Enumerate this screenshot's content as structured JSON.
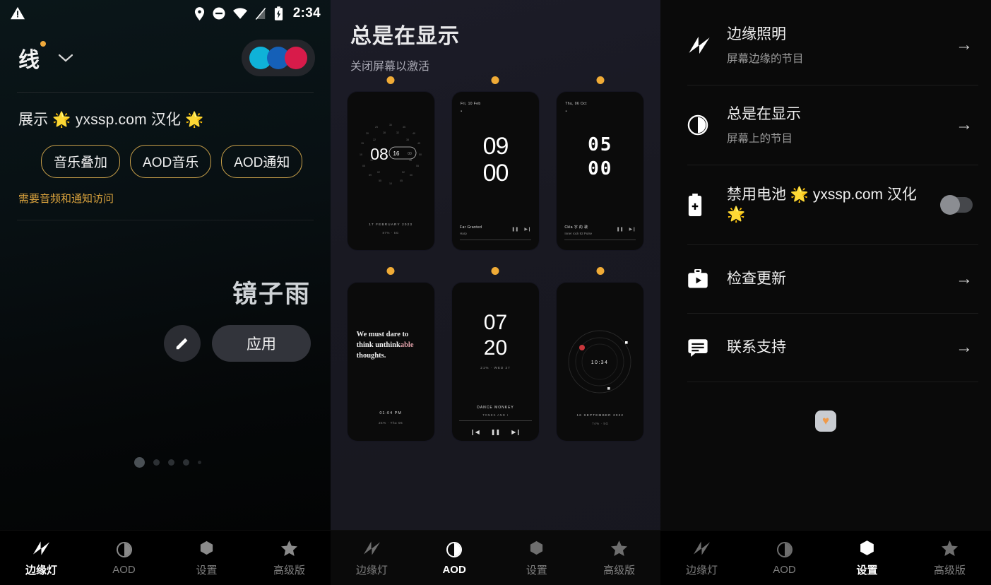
{
  "statusbar": {
    "warning_icon": "warning-triangle",
    "location_icon": "location-pin",
    "dnd_icon": "do-not-disturb",
    "wifi_icon": "wifi",
    "signal_icon": "signal-off",
    "battery_icon": "battery-charging",
    "time": "2:34"
  },
  "panel1": {
    "preset_name": "线",
    "chevron": "⌄",
    "swatches": [
      "#0fb2d8",
      "#1560b8",
      "#d81b4a"
    ],
    "demo": {
      "title": "展示 🌟 yxssp.com 汉化 🌟",
      "chips": [
        "音乐叠加",
        "AOD音乐",
        "AOD通知"
      ],
      "note": "需要音频和通知访问"
    },
    "theme_name": "镜子雨",
    "edit_icon": "pencil-icon",
    "apply_label": "应用",
    "page_dots": 5,
    "active_dot": 0
  },
  "panel2": {
    "title": "总是在显示",
    "subtitle": "关闭屏幕以激活",
    "cards": [
      {
        "style": "dial",
        "hour": "08",
        "minute": "16",
        "second": "00",
        "footer_date": "17 FEBRUARY 2023",
        "footer_meta": "87%  ·  5G"
      },
      {
        "style": "bigclock",
        "date": "Fri, 10 Feb",
        "hour": "09",
        "minute": "00",
        "track": "Far Granted",
        "artist": "Harp",
        "controls": "pause-next"
      },
      {
        "style": "dotclock",
        "date": "Thu, 06 Oct",
        "hour": "05",
        "minute": "00",
        "track": "Ckla 字 的 歌",
        "artist": "Inner rock 92 Pulse",
        "controls": "pause-next"
      },
      {
        "style": "quote",
        "quote_a": "We must dare to think unthink",
        "quote_hl": "able",
        "quote_b": "thoughts.",
        "time": "01:04 PM",
        "meta": "24%  ·  Thu 06"
      },
      {
        "style": "stacked",
        "hour": "07",
        "minute": "20",
        "meta": "21%  ·  WED 27",
        "track": "DANCE MONKEY",
        "artist": "TONES AND I",
        "controls": "prev-pause-next"
      },
      {
        "style": "orbit",
        "time": "10:34",
        "footer_date": "16 SEPTEMBER 2022",
        "footer_meta": "74%  ·  5G"
      }
    ]
  },
  "panel3": {
    "items": [
      {
        "icon": "edge-light-icon",
        "title": "边缘照明",
        "subtitle": "屏幕边缘的节目",
        "action": "arrow"
      },
      {
        "icon": "aod-icon",
        "title": "总是在显示",
        "subtitle": "屏幕上的节目",
        "action": "arrow"
      },
      {
        "icon": "battery-icon",
        "title": "禁用电池 🌟 yxssp.com 汉化 🌟",
        "subtitle": "",
        "action": "toggle",
        "toggle_on": false
      },
      {
        "icon": "update-icon",
        "title": "检查更新",
        "subtitle": "",
        "action": "arrow"
      },
      {
        "icon": "support-icon",
        "title": "联系支持",
        "subtitle": "",
        "action": "arrow"
      }
    ],
    "heart_badge": "♥"
  },
  "nav": {
    "items": [
      {
        "icon": "edge-light-icon",
        "label": "边缘灯"
      },
      {
        "icon": "aod-icon",
        "label": "AOD"
      },
      {
        "icon": "settings-icon",
        "label": "设置"
      },
      {
        "icon": "premium-icon",
        "label": "高级版"
      }
    ],
    "active_p1": 0,
    "active_p2": 1,
    "active_p3": 2
  }
}
